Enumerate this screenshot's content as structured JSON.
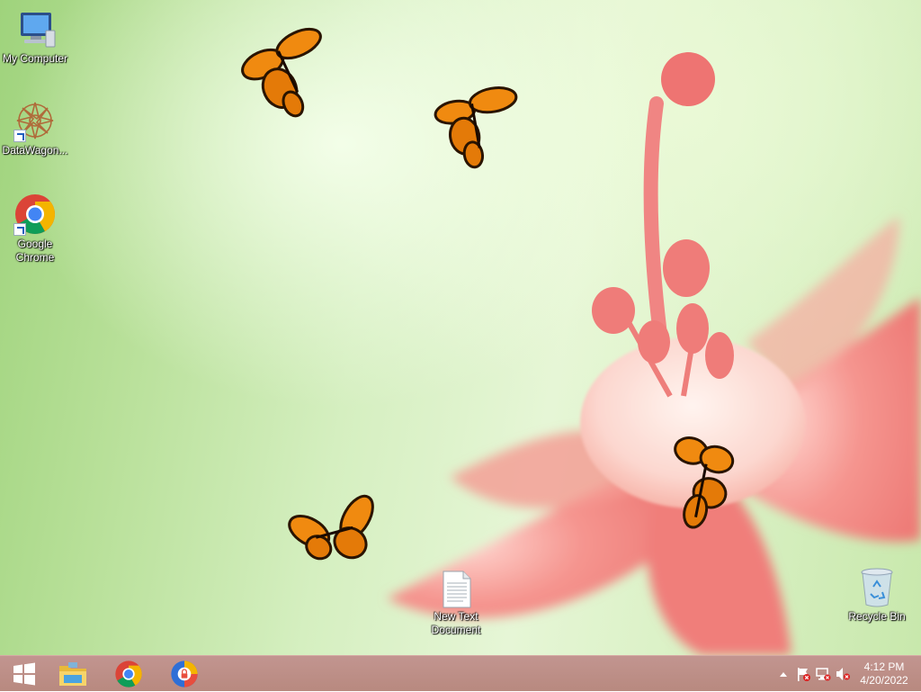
{
  "desktop": {
    "icons": [
      {
        "label": "My Computer",
        "icon": "computer-icon"
      },
      {
        "label": "DataWagon...",
        "icon": "datawagon-icon"
      },
      {
        "label": "Google Chrome",
        "icon": "chrome-icon"
      },
      {
        "label": "New Text Document",
        "icon": "text-document-icon"
      },
      {
        "label": "Recycle Bin",
        "icon": "recycle-bin-icon"
      }
    ]
  },
  "taskbar": {
    "pinned": [
      {
        "icon": "windows-start-icon"
      },
      {
        "icon": "file-explorer-icon"
      },
      {
        "icon": "chrome-icon"
      },
      {
        "icon": "secure-browser-icon"
      }
    ],
    "tray": {
      "icons": [
        "show-hidden-icons-chevron",
        "action-center-flag-icon",
        "network-icon",
        "volume-muted-icon"
      ],
      "time": "4:12 PM",
      "date": "4/20/2022"
    }
  },
  "colors": {
    "taskbar": "#b98a80",
    "wallpaper_green": "#c8e8ac",
    "flower_pink": "#f07a78",
    "butterfly_orange": "#f08a10"
  }
}
